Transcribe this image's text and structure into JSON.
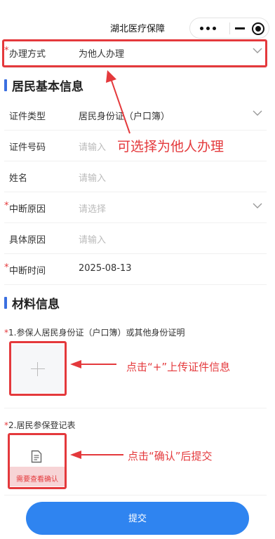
{
  "header": {
    "title": "湖北医疗保障"
  },
  "form": {
    "method": {
      "label": "办理方式",
      "value": "为他人办理"
    },
    "basic_section_title": "居民基本信息",
    "id_type": {
      "label": "证件类型",
      "value": "居民身份证（户口簿）"
    },
    "id_number": {
      "label": "证件号码",
      "placeholder": "请输入"
    },
    "name": {
      "label": "姓名",
      "placeholder": "请输入"
    },
    "reason": {
      "label": "中断原因",
      "placeholder": "请选择"
    },
    "detail": {
      "label": "具体原因",
      "placeholder": "请输入"
    },
    "date": {
      "label": "中断时间",
      "value": "2025-08-13"
    },
    "required_mark": "*",
    "material_section_title": "材料信息",
    "material1_label": "1.参保人居民身份证（户口簿）或其他身份证明",
    "material2_label": "2.居民参保登记表",
    "material2_confirm": "需要查看确认",
    "submit_label": "提交"
  },
  "annotations": {
    "method_tip": "可选择为他人办理",
    "upload_tip": "点击“+”上传证件信息",
    "confirm_tip": "点击“确认”后提交"
  },
  "colors": {
    "accent": "#2f84f0",
    "section_bar": "#3b6fe0",
    "required": "#e4393c",
    "annotation": "#e4393c"
  }
}
